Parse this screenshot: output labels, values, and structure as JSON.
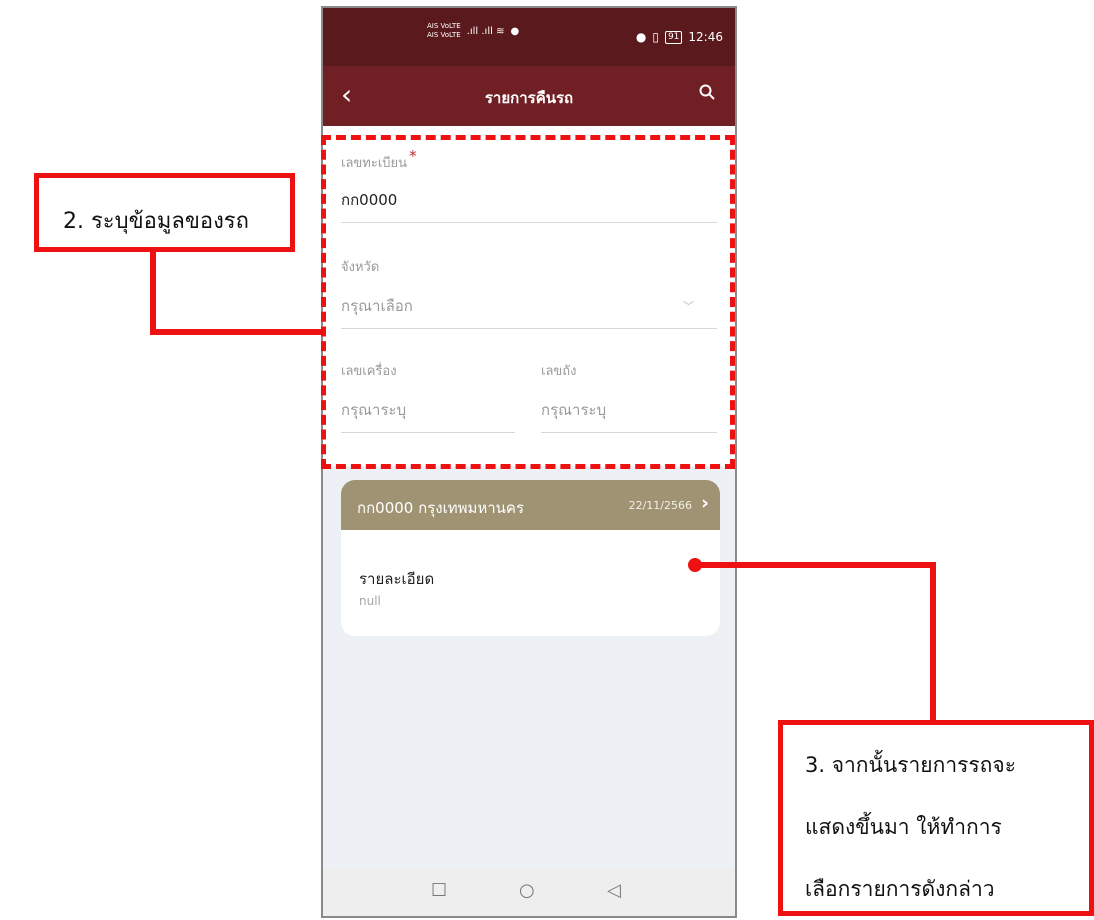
{
  "status_bar": {
    "carrier_top": "AIS VoLTE",
    "carrier_bottom": "AIS VoLTE",
    "signal": ".ıll .ıll ≋",
    "battery": "91",
    "time": "12:46"
  },
  "app_bar": {
    "title": "รายการคืนรถ"
  },
  "form": {
    "plate": {
      "label": "เลขทะเบียน",
      "required": "*",
      "value": "กก0000"
    },
    "province": {
      "label": "จังหวัด",
      "placeholder": "กรุณาเลือก"
    },
    "engine": {
      "label": "เลขเครื่อง",
      "placeholder": "กรุณาระบุ"
    },
    "chassis": {
      "label": "เลขถัง",
      "placeholder": "กรุณาระบุ"
    }
  },
  "result_card": {
    "title": "กก0000 กรุงเทพมหานคร",
    "date": "22/11/2566",
    "detail_label": "รายละเอียด",
    "detail_value": "null"
  },
  "annotations": {
    "step2": "2. ระบุข้อมูลของรถ",
    "step3_line1": "3. จากนั้นรายการรถจะ",
    "step3_line2": "แสดงขึ้นมา ให้ทำการ",
    "step3_line3": "เลือกรายการดังกล่าว"
  },
  "colors": {
    "app_bar": "#702025",
    "status_bar": "#5a1a1d",
    "card_header": "#9f9373",
    "annotation": "#ee1111"
  }
}
